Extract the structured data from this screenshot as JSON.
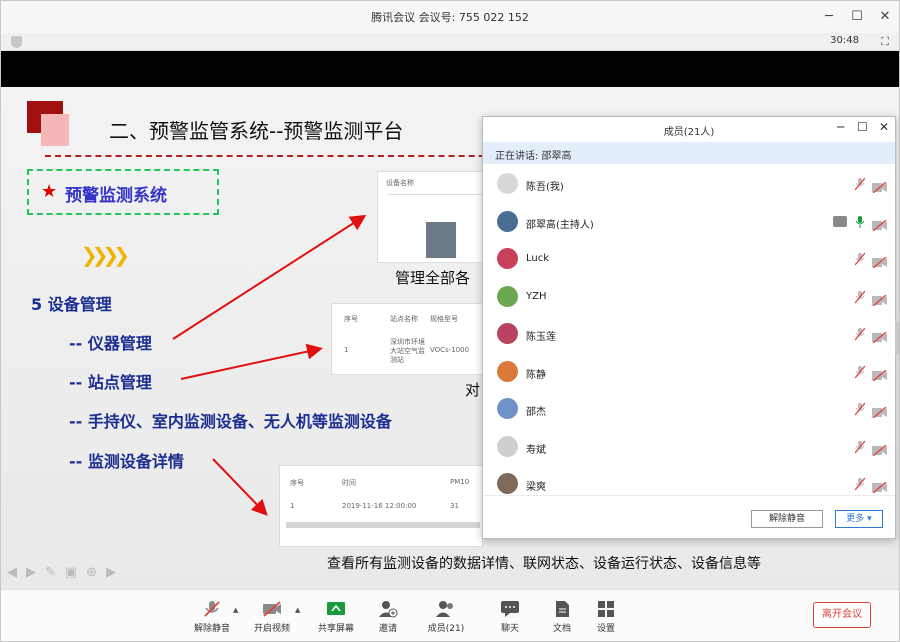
{
  "window": {
    "title": "腾讯会议 会议号: 755 022 152"
  },
  "infobar": {
    "timer": "30:48"
  },
  "slide": {
    "title": "二、预警监管系统--预警监测平台",
    "highlight": "预警监测系统",
    "section": "5 设备管理",
    "items": [
      "-- 仪器管理",
      "-- 站点管理",
      "-- 手持仪、室内监测设备、无人机等监测设备",
      "-- 监测设备详情"
    ],
    "caption_1": "管理全部各",
    "caption_2": "对",
    "caption_3": "查看所有监测设备的数据详情、联网状态、设备运行状态、设备信息等",
    "thumb_headers": {
      "a": [
        "设备名称",
        ""
      ],
      "b": [
        "序号",
        "站点名称",
        "规格型号"
      ],
      "b_row": [
        "1",
        "深圳市环境大站空气监测站",
        "VOCs-1000"
      ],
      "c": [
        "序号",
        "时间",
        "PM10"
      ],
      "c_row": [
        "1",
        "2019-11-16 12:00:00",
        "31"
      ]
    }
  },
  "panel": {
    "title": "成员(21人)",
    "speaking": "正在讲话: 邵翠高",
    "members": [
      {
        "name": "陈吾(我)",
        "avatar": "#d8d8d8",
        "mic": "muted",
        "cam": "off"
      },
      {
        "name": "邵翠高(主持人)",
        "avatar": "#4a6d93",
        "mic": "on",
        "cam": "off",
        "sharing": true
      },
      {
        "name": "Luck",
        "avatar": "#c9405a",
        "mic": "muted",
        "cam": "off"
      },
      {
        "name": "YZH",
        "avatar": "#6aa84f",
        "mic": "muted",
        "cam": "off"
      },
      {
        "name": "陈玉莲",
        "avatar": "#b7435e",
        "mic": "muted",
        "cam": "off"
      },
      {
        "name": "陈静",
        "avatar": "#d97a3a",
        "mic": "muted",
        "cam": "off"
      },
      {
        "name": "邵杰",
        "avatar": "#6f93c8",
        "mic": "muted",
        "cam": "off"
      },
      {
        "name": "寿斌",
        "avatar": "#cfcfcf",
        "mic": "muted",
        "cam": "off"
      },
      {
        "name": "梁爽",
        "avatar": "#7f6a5a",
        "mic": "muted",
        "cam": "off"
      }
    ],
    "unmute_all": "解除静音",
    "more": "更多 ▾"
  },
  "toolbar": {
    "unmute": "解除静音",
    "video": "开启视频",
    "share": "共享屏幕",
    "invite": "邀请",
    "members": "成员(21)",
    "chat": "聊天",
    "docs": "文档",
    "settings": "设置",
    "leave": "离开会议"
  },
  "colors": {
    "accent": "#2e7bd6",
    "danger": "#e0413b",
    "share_green": "#1a9a3c"
  }
}
